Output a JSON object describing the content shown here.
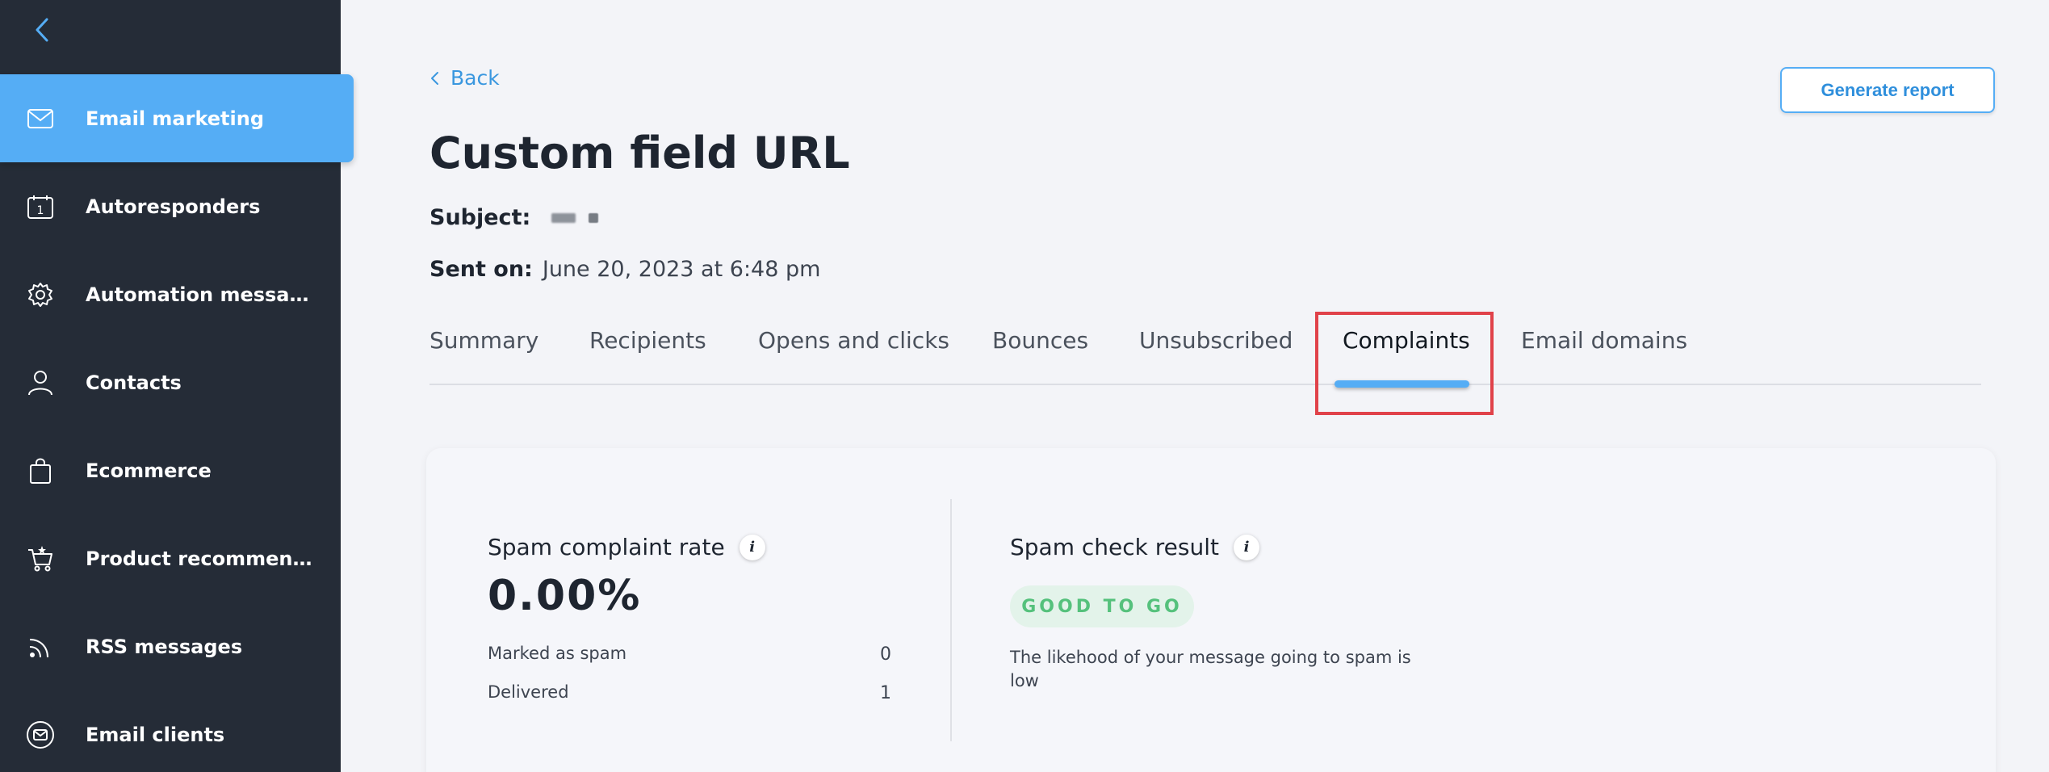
{
  "sidebar": {
    "items": [
      {
        "label": "Email marketing",
        "icon": "mail-icon",
        "active": true
      },
      {
        "label": "Autoresponders",
        "icon": "calendar-icon"
      },
      {
        "label": "Automation messages",
        "icon": "gear-icon"
      },
      {
        "label": "Contacts",
        "icon": "person-icon"
      },
      {
        "label": "Ecommerce",
        "icon": "shopping-bag-icon"
      },
      {
        "label": "Product recommendat…",
        "icon": "cart-star-icon"
      },
      {
        "label": "RSS messages",
        "icon": "rss-icon"
      },
      {
        "label": "Email clients",
        "icon": "email-client-icon"
      }
    ]
  },
  "header": {
    "back_label": "Back",
    "generate_report_label": "Generate report",
    "title": "Custom field URL",
    "subject_label": "Subject:",
    "sent_on_label": "Sent on:",
    "sent_on_value": "June 20, 2023 at 6:48 pm"
  },
  "tabs": [
    {
      "label": "Summary"
    },
    {
      "label": "Recipients"
    },
    {
      "label": "Opens and clicks"
    },
    {
      "label": "Bounces"
    },
    {
      "label": "Unsubscribed"
    },
    {
      "label": "Complaints",
      "active": true
    },
    {
      "label": "Email domains"
    }
  ],
  "complaints": {
    "rate_label": "Spam complaint rate",
    "rate_value": "0.00%",
    "stats": [
      {
        "label": "Marked as spam",
        "value": "0"
      },
      {
        "label": "Delivered",
        "value": "1"
      }
    ],
    "spam_check_label": "Spam check result",
    "badge": "GOOD TO GO",
    "spam_check_desc": "The likehood of your message going to spam is low"
  },
  "colors": {
    "sidebar_bg": "#252c37",
    "accent": "#55adf5",
    "highlight": "#e0424a",
    "good_badge_bg": "#e3f3ea",
    "good_badge_text": "#55c17c"
  }
}
